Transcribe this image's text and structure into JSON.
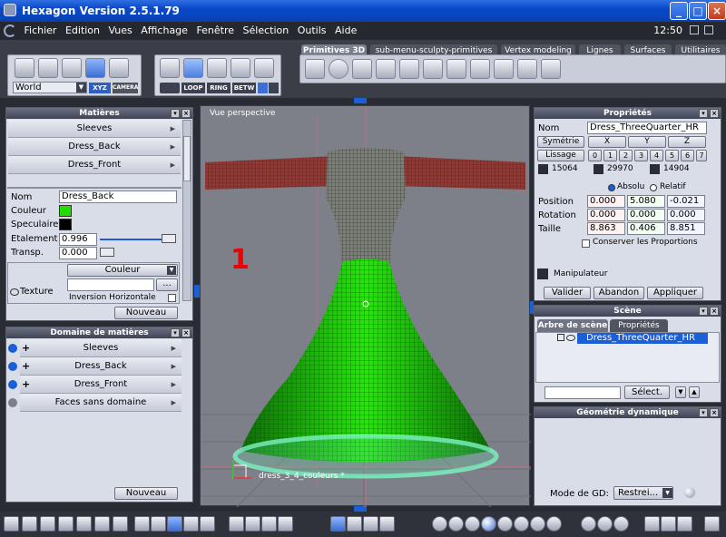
{
  "window": {
    "title": "Hexagon Version 2.5.1.79",
    "clock": "12:50"
  },
  "menu": [
    "Fichier",
    "Edition",
    "Vues",
    "Affichage",
    "Fenêtre",
    "Sélection",
    "Outils",
    "Aide"
  ],
  "tabs": [
    "Primitives 3D",
    "sub-menu-sculpty-primitives",
    "Vertex modeling",
    "Lignes",
    "Surfaces",
    "Utilitaires"
  ],
  "toolbar": {
    "coord_dropdown": "World",
    "xyz_label": "XYZ",
    "camera_label": "CAMERA",
    "loop_label": "LOOP",
    "ring_label": "RING",
    "betw_label": "BETW"
  },
  "materials": {
    "title": "Matières",
    "items": [
      "Sleeves",
      "Dress_Back",
      "Dress_Front"
    ],
    "nom_label": "Nom",
    "nom_value": "Dress_Back",
    "couleur_label": "Couleur",
    "couleur_color": "#22dd00",
    "speculaire_label": "Speculaire",
    "etalement_label": "Etalement",
    "etalement_value": "0.996",
    "transp_label": "Transp.",
    "transp_value": "0.000",
    "texture_label": "Texture",
    "texture_dropdown": "Couleur",
    "texture_browse": "...",
    "inversion_label": "Inversion Horizontale",
    "nouveau_label": "Nouveau"
  },
  "domain": {
    "title": "Domaine de matières",
    "items": [
      "Sleeves",
      "Dress_Back",
      "Dress_Front",
      "Faces sans domaine"
    ],
    "nouveau_label": "Nouveau"
  },
  "viewport": {
    "label": "Vue perspective",
    "annotation": "1",
    "object_label": "dress_3_4_couleurs *"
  },
  "properties": {
    "title": "Propriétés",
    "nom_label": "Nom",
    "nom_value": "Dress_ThreeQuarter_HR",
    "symetrie_label": "Symétrie",
    "lissage_label": "Lissage",
    "axes": [
      "X",
      "Y",
      "Z"
    ],
    "lissage_levels": [
      "0",
      "1",
      "2",
      "3",
      "4",
      "5",
      "6",
      "7"
    ],
    "counts": [
      "15064",
      "29970",
      "14904"
    ],
    "absolu_label": "Absolu",
    "relatif_label": "Relatif",
    "position_label": "Position",
    "position": [
      "0.000",
      "5.080",
      "-0.021"
    ],
    "rotation_label": "Rotation",
    "rotation": [
      "0.000",
      "0.000",
      "0.000"
    ],
    "taille_label": "Taille",
    "taille": [
      "8.863",
      "0.406",
      "8.851"
    ],
    "conserver_label": "Conserver les Proportions",
    "manipulateur_label": "Manipulateur",
    "valider_label": "Valider",
    "abandon_label": "Abandon",
    "appliquer_label": "Appliquer"
  },
  "scene": {
    "title": "Scène",
    "tab_tree": "Arbre de scène",
    "tab_props": "Propriétés",
    "item": "Dress_ThreeQuarter_HR",
    "select_label": "Sélect."
  },
  "geo": {
    "title": "Géométrie dynamique",
    "mode_label": "Mode de GD:",
    "mode_value": "Restrei..."
  }
}
